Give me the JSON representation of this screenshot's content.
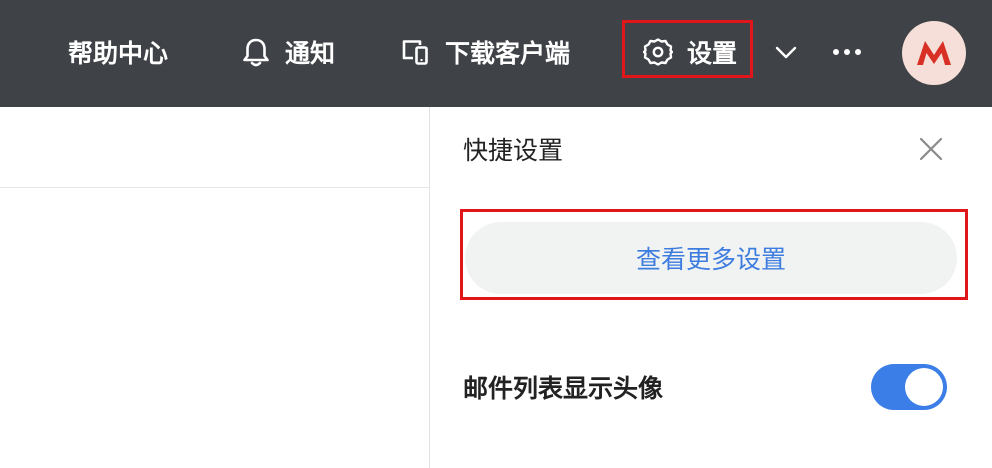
{
  "header": {
    "help_label": "帮助中心",
    "notify_label": "通知",
    "download_label": "下载客户端",
    "settings_label": "设置"
  },
  "icons": {
    "notify": "bell-icon",
    "download": "devices-icon",
    "settings": "gear-icon",
    "expand": "chevron-down-icon",
    "more": "more-icon",
    "close": "close-icon"
  },
  "quick_settings": {
    "title": "快捷设置",
    "view_more_label": "查看更多设置",
    "toggle_label": "邮件列表显示头像",
    "toggle_on": true
  },
  "colors": {
    "topbar_bg": "#3f4347",
    "accent_blue": "#3b7ee8",
    "highlight_red": "#e0161b",
    "avatar_bg": "#f6dfd8",
    "avatar_logo": "#d93025"
  }
}
